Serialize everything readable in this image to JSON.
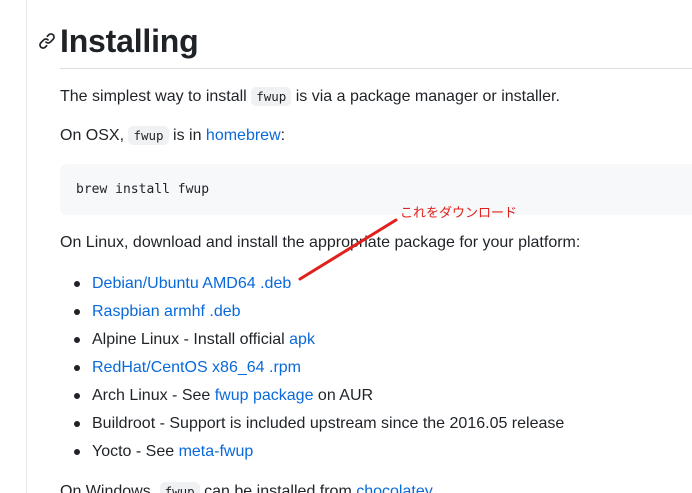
{
  "heading": {
    "title": "Installing"
  },
  "intro": {
    "before": "The simplest way to install ",
    "code": "fwup",
    "after": " is via a package manager or installer."
  },
  "osx": {
    "before": "On OSX, ",
    "code": "fwup",
    "middle": " is in ",
    "link": "homebrew",
    "after": ":"
  },
  "code_block": {
    "command": "brew install fwup"
  },
  "linux": {
    "text": "On Linux, download and install the appropriate package for your platform:"
  },
  "packages": {
    "debian": {
      "link": "Debian/Ubuntu AMD64 .deb"
    },
    "raspbian": {
      "link": "Raspbian armhf .deb"
    },
    "alpine": {
      "text": "Alpine Linux - Install official ",
      "link": "apk"
    },
    "redhat": {
      "link": "RedHat/CentOS x86_64 .rpm"
    },
    "arch": {
      "text": "Arch Linux - See ",
      "link": "fwup package",
      "after": " on AUR"
    },
    "buildroot": {
      "text": "Buildroot - Support is included upstream since the 2016.05 release"
    },
    "yocto": {
      "text": "Yocto - See ",
      "link": "meta-fwup"
    }
  },
  "windows": {
    "before": "On Windows, ",
    "code": "fwup",
    "middle": " can be installed from ",
    "link": "chocolatey"
  },
  "annotation": {
    "label": "これをダウンロード",
    "color": "#e0201c"
  }
}
